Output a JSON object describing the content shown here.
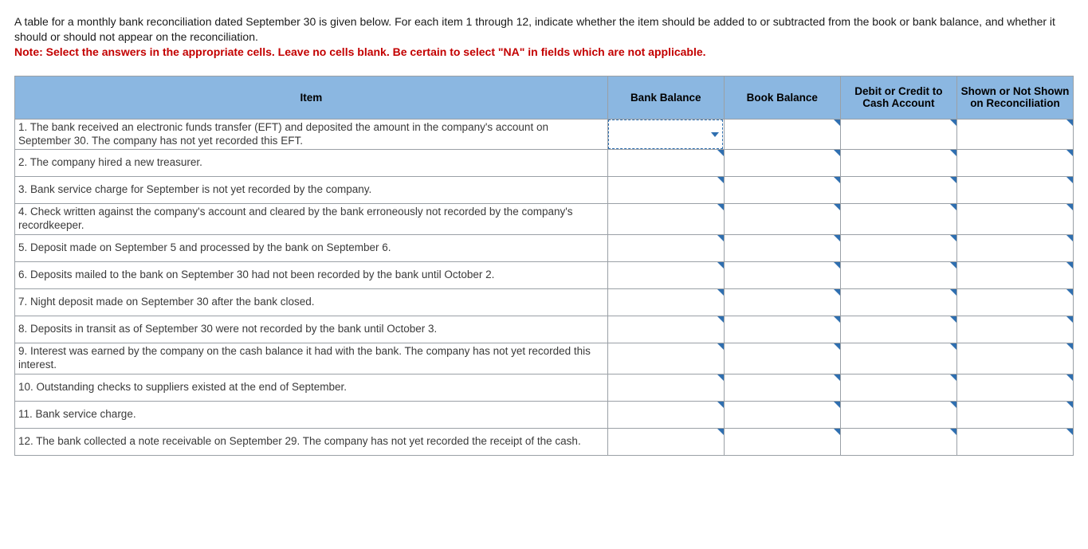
{
  "intro": {
    "line1": "A table for a monthly bank reconciliation dated September 30 is given below. For each item 1 through 12, indicate whether the item should be added to or subtracted from the book or bank balance, and whether it should or should not appear on the reconciliation.",
    "note": "Note: Select the answers in the appropriate cells. Leave no cells blank. Be certain to select \"NA\" in fields which are not applicable."
  },
  "headers": {
    "item": "Item",
    "bank_balance": "Bank Balance",
    "book_balance": "Book Balance",
    "debit_credit": "Debit or Credit to Cash Account",
    "shown": "Shown or Not Shown on Reconciliation"
  },
  "rows": [
    {
      "text": "1. The bank received an electronic funds transfer (EFT) and deposited the amount in the company's account on September 30. The company has not yet recorded this EFT."
    },
    {
      "text": "2. The company hired a new treasurer."
    },
    {
      "text": "3. Bank service charge for September is not yet recorded by the company."
    },
    {
      "text": "4. Check written against the company's account and cleared by the bank erroneously not recorded by the company's recordkeeper."
    },
    {
      "text": "5. Deposit made on September 5 and processed by the bank on September 6."
    },
    {
      "text": "6. Deposits mailed to the bank on September 30 had not been recorded by the bank until October 2."
    },
    {
      "text": "7. Night deposit made on September 30 after the bank closed."
    },
    {
      "text": "8. Deposits in transit as of September 30 were not recorded by the bank until October 3."
    },
    {
      "text": "9. Interest was earned by the company on the cash balance it had with the bank. The company has not yet recorded this interest."
    },
    {
      "text": "10. Outstanding checks to suppliers existed at the end of September."
    },
    {
      "text": "11. Bank service charge."
    },
    {
      "text": "12. The bank collected a note receivable on September 29. The company has not yet recorded the receipt of the cash."
    }
  ],
  "answer_columns": [
    "bank_balance",
    "book_balance",
    "debit_credit",
    "shown"
  ],
  "active_cell": {
    "row": 0,
    "col": "bank_balance"
  }
}
